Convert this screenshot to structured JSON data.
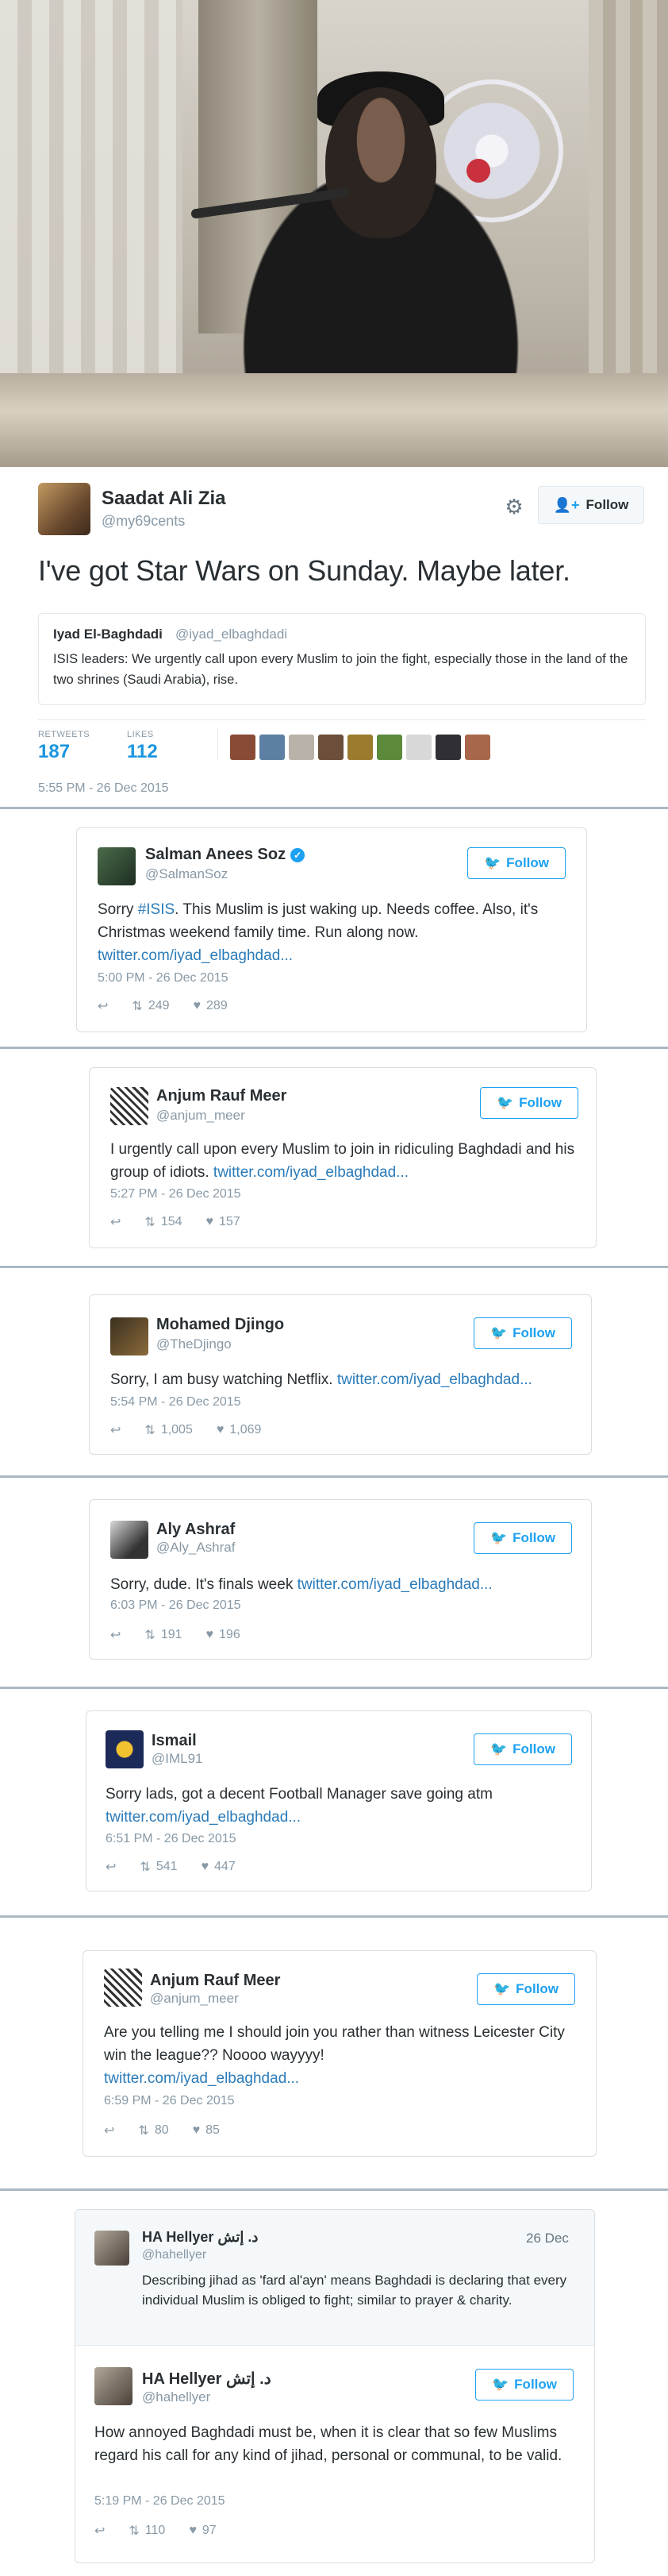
{
  "main_tweet": {
    "name": "Saadat Ali Zia",
    "handle": "@my69cents",
    "follow_label": "Follow",
    "text": "I've got Star Wars on Sunday. Maybe later.",
    "quote": {
      "name": "Iyad El-Baghdadi",
      "handle": "@iyad_elbaghdadi",
      "text": "ISIS leaders: We urgently call upon every Muslim to join the fight, especially those in the land of the two shrines (Saudi Arabia), rise."
    },
    "retweets_label": "RETWEETS",
    "retweets": "187",
    "likes_label": "LIKES",
    "likes": "112",
    "timestamp": "5:55 PM - 26 Dec 2015"
  },
  "cards": [
    {
      "name": "Salman Anees Soz",
      "handle": "@SalmanSoz",
      "follow_label": "Follow",
      "text": "Sorry ",
      "hashtag": "#ISIS",
      "text2": ". This Muslim is just waking up. Needs coffee. Also, it's Christmas weekend family time. Run along now.",
      "link": "twitter.com/iyad_elbaghdad...",
      "time": "5:00 PM - 26 Dec 2015",
      "retweets": "249",
      "likes": "289"
    },
    {
      "name": "Anjum Rauf Meer",
      "handle": "@anjum_meer",
      "follow_label": "Follow",
      "text": "I urgently call upon every Muslim to join in ridiculing Baghdadi and his group of idiots. ",
      "link": "twitter.com/iyad_elbaghdad...",
      "time": "5:27 PM - 26 Dec 2015",
      "retweets": "154",
      "likes": "157"
    },
    {
      "name": "Mohamed Djingo",
      "handle": "@TheDjingo",
      "follow_label": "Follow",
      "text": "Sorry, I am busy watching Netflix. ",
      "link": "twitter.com/iyad_elbaghdad...",
      "time": "5:54 PM - 26 Dec 2015",
      "retweets": "1,005",
      "likes": "1,069"
    },
    {
      "name": "Aly Ashraf",
      "handle": "@Aly_Ashraf",
      "follow_label": "Follow",
      "text": "Sorry, dude. It's finals week ",
      "link": "twitter.com/iyad_elbaghdad...",
      "time": "6:03 PM - 26 Dec 2015",
      "retweets": "191",
      "likes": "196"
    },
    {
      "name": "Ismail",
      "handle": "@IML91",
      "follow_label": "Follow",
      "text": "Sorry lads, got a decent Football Manager save going atm",
      "link": "twitter.com/iyad_elbaghdad...",
      "time": "6:51 PM - 26 Dec 2015",
      "retweets": "541",
      "likes": "447"
    },
    {
      "name": "Anjum Rauf Meer",
      "handle": "@anjum_meer",
      "follow_label": "Follow",
      "text": "Are you telling me I should join you rather than witness Leicester City win the league?? Noooo wayyyy!",
      "link": "twitter.com/iyad_elbaghdad...",
      "time": "6:59 PM - 26 Dec 2015",
      "retweets": "80",
      "likes": "85"
    }
  ],
  "hellyer": {
    "reply": {
      "name": "HA Hellyer د. إتش",
      "handle": "@hahellyer",
      "date": "26 Dec",
      "text": "Describing jihad as 'fard al'ayn' means Baghdadi is declaring that every individual Muslim is obliged to fight; similar to prayer & charity."
    },
    "main": {
      "name": "HA Hellyer د. إتش",
      "handle": "@hahellyer",
      "follow_label": "Follow",
      "text": "How annoyed Baghdadi must be, when it is clear that so few Muslims regard his call for any kind of jihad, personal or communal, to be valid.",
      "time": "5:19 PM - 26 Dec 2015",
      "retweets": "110",
      "likes": "97"
    }
  },
  "icons": {
    "gear": "gear-icon",
    "follow": "add-user-icon",
    "bird": "twitter-bird-icon",
    "reply": "reply-icon",
    "retweet": "retweet-icon",
    "like": "heart-icon",
    "verified": "verified-icon"
  },
  "colors": {
    "link": "#2b7bb9",
    "accent": "#1da1f2",
    "stat_number": "#1b95e0",
    "muted": "#8899a6"
  }
}
